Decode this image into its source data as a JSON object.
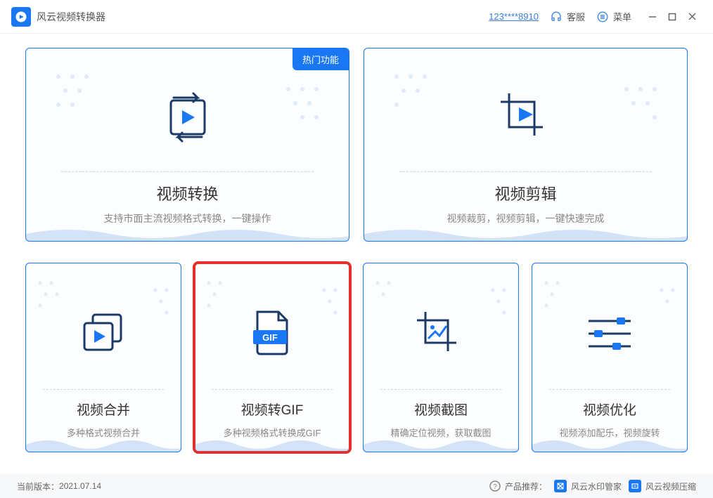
{
  "header": {
    "app_title": "风云视频转换器",
    "phone": "123****8910",
    "service_label": "客服",
    "menu_label": "菜单"
  },
  "cards": {
    "hot_label": "热门功能",
    "video_convert": {
      "title": "视频转换",
      "sub": "支持市面主流视频格式转换，一键操作"
    },
    "video_edit": {
      "title": "视频剪辑",
      "sub": "视频裁剪，视频剪辑，一键快速完成"
    },
    "video_merge": {
      "title": "视频合并",
      "sub": "多种格式视频合并"
    },
    "video_gif": {
      "title": "视频转GIF",
      "sub": "多种视频格式转换成GIF"
    },
    "video_snap": {
      "title": "视频截图",
      "sub": "精确定位视频，获取截图"
    },
    "video_opt": {
      "title": "视频优化",
      "sub": "视频添加配乐，视频旋转"
    }
  },
  "footer": {
    "version_label": "当前版本：",
    "version": "2021.07.14",
    "rec_label": "产品推荐：",
    "rec1": "风云水印管家",
    "rec2": "风云视频压缩"
  }
}
